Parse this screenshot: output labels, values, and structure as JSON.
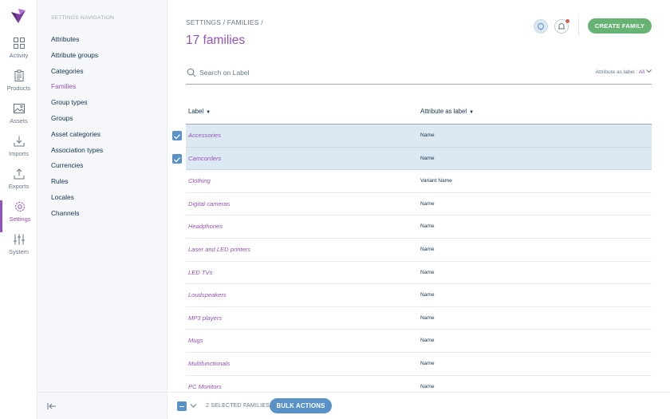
{
  "rail": {
    "items": [
      {
        "label": "Activity",
        "icon": "activity-icon"
      },
      {
        "label": "Products",
        "icon": "products-icon"
      },
      {
        "label": "Assets",
        "icon": "assets-icon"
      },
      {
        "label": "Imports",
        "icon": "imports-icon"
      },
      {
        "label": "Exports",
        "icon": "exports-icon"
      },
      {
        "label": "Settings",
        "icon": "settings-icon",
        "active": true
      },
      {
        "label": "System",
        "icon": "system-icon"
      }
    ]
  },
  "nav": {
    "title": "SETTINGS NAVIGATION",
    "items": [
      {
        "label": "Attributes"
      },
      {
        "label": "Attribute groups"
      },
      {
        "label": "Categories"
      },
      {
        "label": "Families",
        "active": true
      },
      {
        "label": "Group types"
      },
      {
        "label": "Groups"
      },
      {
        "label": "Asset categories"
      },
      {
        "label": "Association types"
      },
      {
        "label": "Currencies"
      },
      {
        "label": "Rules"
      },
      {
        "label": "Locales"
      },
      {
        "label": "Channels"
      }
    ]
  },
  "header": {
    "breadcrumb": "SETTINGS / FAMILIES /",
    "title": "17 families",
    "create_label": "CREATE FAMILY"
  },
  "search": {
    "placeholder": "Search on Label",
    "attr_filter_label": "Attribute as label :",
    "attr_filter_value": "All"
  },
  "table": {
    "columns": [
      "Label",
      "Attribute as label"
    ],
    "rows": [
      {
        "label": "Accessories",
        "attr": "Name",
        "selected": true
      },
      {
        "label": "Camcorders",
        "attr": "Name",
        "selected": true
      },
      {
        "label": "Clothing",
        "attr": "Variant Name",
        "selected": false
      },
      {
        "label": "Digital cameras",
        "attr": "Name",
        "selected": false
      },
      {
        "label": "Headphones",
        "attr": "Name",
        "selected": false
      },
      {
        "label": "Laser and LED printers",
        "attr": "Name",
        "selected": false
      },
      {
        "label": "LED TVs",
        "attr": "Name",
        "selected": false
      },
      {
        "label": "Loudspeakers",
        "attr": "Name",
        "selected": false
      },
      {
        "label": "MP3 players",
        "attr": "Name",
        "selected": false
      },
      {
        "label": "Mugs",
        "attr": "Name",
        "selected": false
      },
      {
        "label": "Multifunctionals",
        "attr": "Name",
        "selected": false
      },
      {
        "label": "PC Monitors",
        "attr": "Name",
        "selected": false
      }
    ]
  },
  "bottom": {
    "selected_text": "2 SELECTED FAMILIES",
    "bulk_label": "BULK ACTIONS"
  },
  "colors": {
    "accent": "#9452ba",
    "primary": "#5992c7",
    "success": "#67b373",
    "selected_row": "#dde9f2",
    "alert": "#d4604f"
  }
}
